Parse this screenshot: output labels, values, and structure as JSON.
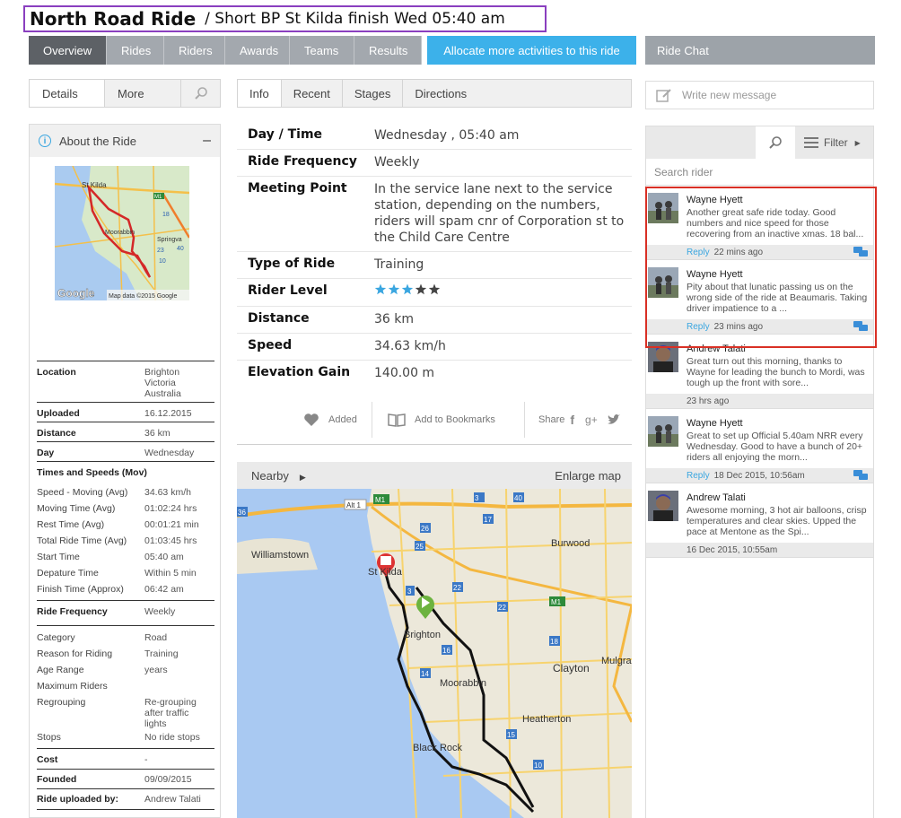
{
  "header": {
    "title": "North Road Ride",
    "subtitle": "/ Short BP St Kilda finish Wed 05:40 am"
  },
  "tabs": [
    {
      "label": "Overview",
      "active": true
    },
    {
      "label": "Rides"
    },
    {
      "label": "Riders"
    },
    {
      "label": "Awards"
    },
    {
      "label": "Teams"
    },
    {
      "label": "Results"
    }
  ],
  "allocate_button": "Allocate more activities to this ride",
  "chat": {
    "title": "Ride Chat",
    "write_placeholder": "Write new message",
    "filter_label": "Filter",
    "search_placeholder": "Search rider",
    "items": [
      {
        "name": "Wayne Hyett",
        "text": "Another great safe ride today. Good numbers and nice speed for those recovering from an inactive xmas. 18 bal...",
        "reply": "Reply",
        "time": "22 mins ago",
        "has_reply": true
      },
      {
        "name": "Wayne Hyett",
        "text": "Pity about that lunatic passing us on the wrong side of the ride at Beaumaris. Taking driver impatience to a ...",
        "reply": "Reply",
        "time": "23 mins ago",
        "has_reply": true
      },
      {
        "name": "Andrew Talati",
        "text": "Great turn out this morning, thanks to Wayne for leading the bunch to Mordi, was tough up the front with sore...",
        "reply": "",
        "time": "23 hrs ago",
        "has_reply": false
      },
      {
        "name": "Wayne Hyett",
        "text": "Great to set up Official 5.40am NRR every Wednesday. Good to have a bunch of 20+ riders all enjoying the morn...",
        "reply": "Reply",
        "time": "18 Dec 2015, 10:56am",
        "has_reply": true
      },
      {
        "name": "Andrew Talati",
        "text": "Awesome morning, 3 hot air balloons, crisp temperatures and clear skies. Upped the pace at Mentone as the Spi...",
        "reply": "",
        "time": "16 Dec 2015, 10:55am",
        "has_reply": false
      }
    ]
  },
  "left": {
    "subtabs": {
      "details": "Details",
      "more": "More"
    },
    "about_title": "About the Ride",
    "minimap": {
      "label1": "St Kilda",
      "label2": "Moorabbin",
      "label3": "Springva",
      "google": "Google",
      "credit": "Map data ©2015 Google",
      "markers": [
        "M1",
        "18",
        "23",
        "40",
        "10"
      ]
    },
    "location": {
      "label": "Location",
      "lines": [
        "Brighton",
        "Victoria",
        "Australia"
      ]
    },
    "uploaded": {
      "label": "Uploaded",
      "value": "16.12.2015"
    },
    "distance": {
      "label": "Distance",
      "value": "36 km"
    },
    "day": {
      "label": "Day",
      "value": "Wednesday"
    },
    "times_heading": "Times and Speeds (Mov)",
    "times": [
      {
        "k": "Speed - Moving (Avg)",
        "v": "34.63 km/h"
      },
      {
        "k": "Moving Time (Avg)",
        "v": "01:02:24 hrs"
      },
      {
        "k": "Rest Time (Avg)",
        "v": "00:01:21 min"
      },
      {
        "k": "Total Ride Time (Avg)",
        "v": "01:03:45 hrs"
      },
      {
        "k": "Start Time",
        "v": "05:40 am"
      },
      {
        "k": "Depature Time",
        "v": "Within 5 min"
      },
      {
        "k": "Finish Time (Approx)",
        "v": "06:42 am"
      }
    ],
    "frequency": {
      "label": "Ride Frequency",
      "value": "Weekly"
    },
    "misc": [
      {
        "k": "Category",
        "v": "Road"
      },
      {
        "k": "Reason for Riding",
        "v": "Training"
      },
      {
        "k": "Age Range",
        "v": "years"
      },
      {
        "k": "Maximum Riders",
        "v": ""
      }
    ],
    "regrouping": {
      "label": "Regrouping",
      "lines": [
        "Re-grouping",
        "after traffic",
        "lights"
      ]
    },
    "stops": {
      "label": "Stops",
      "value": "No ride stops"
    },
    "cost": {
      "label": "Cost",
      "value": "-"
    },
    "founded": {
      "label": "Founded",
      "value": "09/09/2015"
    },
    "uploaded_by": {
      "label": "Ride uploaded by:",
      "value": "Andrew Talati"
    }
  },
  "mid": {
    "tabs": [
      "Info",
      "Recent",
      "Stages",
      "Directions"
    ],
    "info": [
      {
        "k": "Day / Time",
        "v": "Wednesday , 05:40 am"
      },
      {
        "k": "Ride Frequency",
        "v": "Weekly"
      },
      {
        "k": "Meeting Point",
        "v": "In the service lane next to the service station, depending on the numbers, riders will spam cnr of Corporation st to the Child Care Centre"
      },
      {
        "k": "Type of Ride",
        "v": "Training"
      },
      {
        "k": "Rider Level",
        "v": ""
      },
      {
        "k": "Distance",
        "v": "36 km"
      },
      {
        "k": "Speed",
        "v": "34.63 km/h"
      },
      {
        "k": "Elevation Gain",
        "v": "140.00 m"
      }
    ],
    "rider_level": {
      "filled": 3,
      "total": 5,
      "filled_color": "#3aa6e0",
      "empty_color": "#444444"
    },
    "actions": {
      "added": "Added",
      "bookmark": "Add to Bookmarks",
      "share": "Share"
    },
    "nearby": "Nearby",
    "enlarge": "Enlarge map",
    "map_labels": {
      "williamstown": "Williamstown",
      "stkilda": "St Kilda",
      "brighton": "Brighton",
      "moorabbin": "Moorabbin",
      "blackrock": "Black Rock",
      "burwood": "Burwood",
      "clayton": "Clayton",
      "heatherton": "Heatherton",
      "mulgra": "Mulgra",
      "alt1": "Alt 1",
      "m1": "M1",
      "m1b": "M1"
    },
    "map_markers": [
      "36",
      "26",
      "17",
      "25",
      "3",
      "22",
      "16",
      "18",
      "14",
      "22",
      "10",
      "15",
      "3",
      "40"
    ]
  }
}
